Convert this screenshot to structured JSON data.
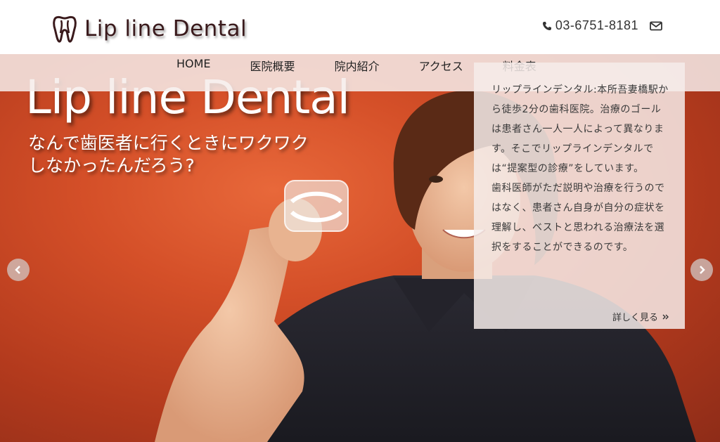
{
  "header": {
    "logo_text": "Lip line Dental",
    "phone": "03-6751-8181"
  },
  "nav": {
    "items": [
      "HOME",
      "医院概要",
      "院内紹介",
      "アクセス",
      "料金表"
    ]
  },
  "hero": {
    "title": "Lip line Dental",
    "subtitle_line1": "なんで歯医者に行くときにワクワク",
    "subtitle_line2": "しなかったんだろう?"
  },
  "panel": {
    "paragraph1": "リップラインデンタル:本所吾妻橋駅から徒歩2分の歯科医院。治療のゴールは患者さん一人一人によって異なります。そこでリップラインデンタルでは“提案型の診療”をしています。",
    "paragraph2": "歯科医師がただ説明や治療を行うのではなく、患者さん自身が自分の症状を理解し、ベストと思われる治療法を選択をすることができるのです。",
    "more_label": "詳しく見る"
  },
  "colors": {
    "hero_orange": "#d44f28",
    "panel_bg": "#f6ecea",
    "logo_dark": "#3a1a1c"
  },
  "icons": {
    "tooth": "tooth-icon",
    "phone": "phone-icon",
    "mail": "mail-icon",
    "prev": "chevron-left-icon",
    "next": "chevron-right-icon"
  }
}
